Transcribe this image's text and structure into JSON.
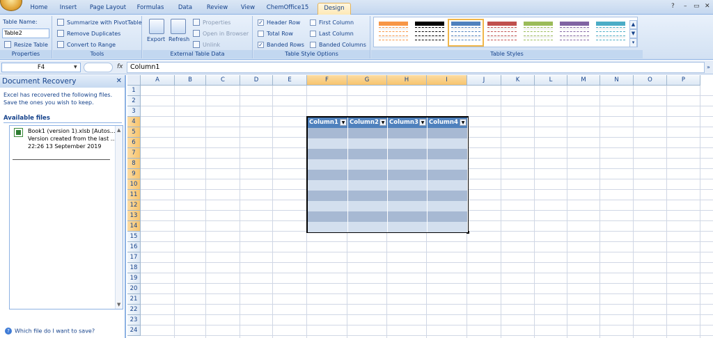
{
  "ribbon": {
    "tabs": [
      "Home",
      "Insert",
      "Page Layout",
      "Formulas",
      "Data",
      "Review",
      "View",
      "ChemOffice15",
      "Design"
    ],
    "active_tab": "Design",
    "window_controls": [
      "?",
      "–",
      "▭",
      "✕"
    ],
    "properties": {
      "table_name_label": "Table Name:",
      "table_name_value": "Table2",
      "resize_label": "Resize Table",
      "group_label": "Properties"
    },
    "tools": {
      "summarize": "Summarize with PivotTable",
      "remove_dup": "Remove Duplicates",
      "convert": "Convert to Range",
      "group_label": "Tools"
    },
    "external": {
      "export": "Export",
      "refresh": "Refresh",
      "properties": "Properties",
      "open_browser": "Open in Browser",
      "unlink": "Unlink",
      "group_label": "External Table Data"
    },
    "style_options": {
      "header_row": "Header Row",
      "total_row": "Total Row",
      "banded_rows": "Banded Rows",
      "first_column": "First Column",
      "last_column": "Last Column",
      "banded_columns": "Banded Columns",
      "group_label": "Table Style Options"
    },
    "table_styles": {
      "group_label": "Table Styles",
      "swatches": [
        "#f79646",
        "#000000",
        "#4f81bd",
        "#c0504d",
        "#9bbb59",
        "#8064a2",
        "#4bacc6"
      ],
      "selected_index": 2
    }
  },
  "formula_bar": {
    "cell_ref": "F4",
    "fx": "fx",
    "content": "Column1"
  },
  "recovery": {
    "title": "Document Recovery",
    "close": "✕",
    "description": "Excel has recovered the following files.  Save the ones you wish to keep.",
    "available_files": "Available files",
    "file_name": "Book1 (version 1).xlsb  [Autos...",
    "file_version": "Version created from the last ...",
    "file_time": "22:26 13 September 2019",
    "help_link": "Which file do I want to save?"
  },
  "grid": {
    "columns": [
      "A",
      "B",
      "C",
      "D",
      "E",
      "F",
      "G",
      "H",
      "I",
      "J",
      "K",
      "L",
      "M",
      "N",
      "O",
      "P"
    ],
    "rows": [
      "1",
      "2",
      "3",
      "4",
      "5",
      "6",
      "7",
      "8",
      "9",
      "10",
      "11",
      "12",
      "13",
      "14",
      "15",
      "16",
      "17",
      "18",
      "19",
      "20",
      "21",
      "22",
      "23",
      "24"
    ],
    "highlighted_columns": [
      "F",
      "G",
      "H",
      "I"
    ],
    "highlighted_rows": [
      "4",
      "5",
      "6",
      "7",
      "8",
      "9",
      "10",
      "11",
      "12",
      "13",
      "14"
    ]
  },
  "table": {
    "headers": [
      "Column1",
      "Column2",
      "Column3",
      "Column4"
    ],
    "header_color": "#4f81bd",
    "band_colors": [
      "#a7b9d3",
      "#d3dfee"
    ]
  }
}
